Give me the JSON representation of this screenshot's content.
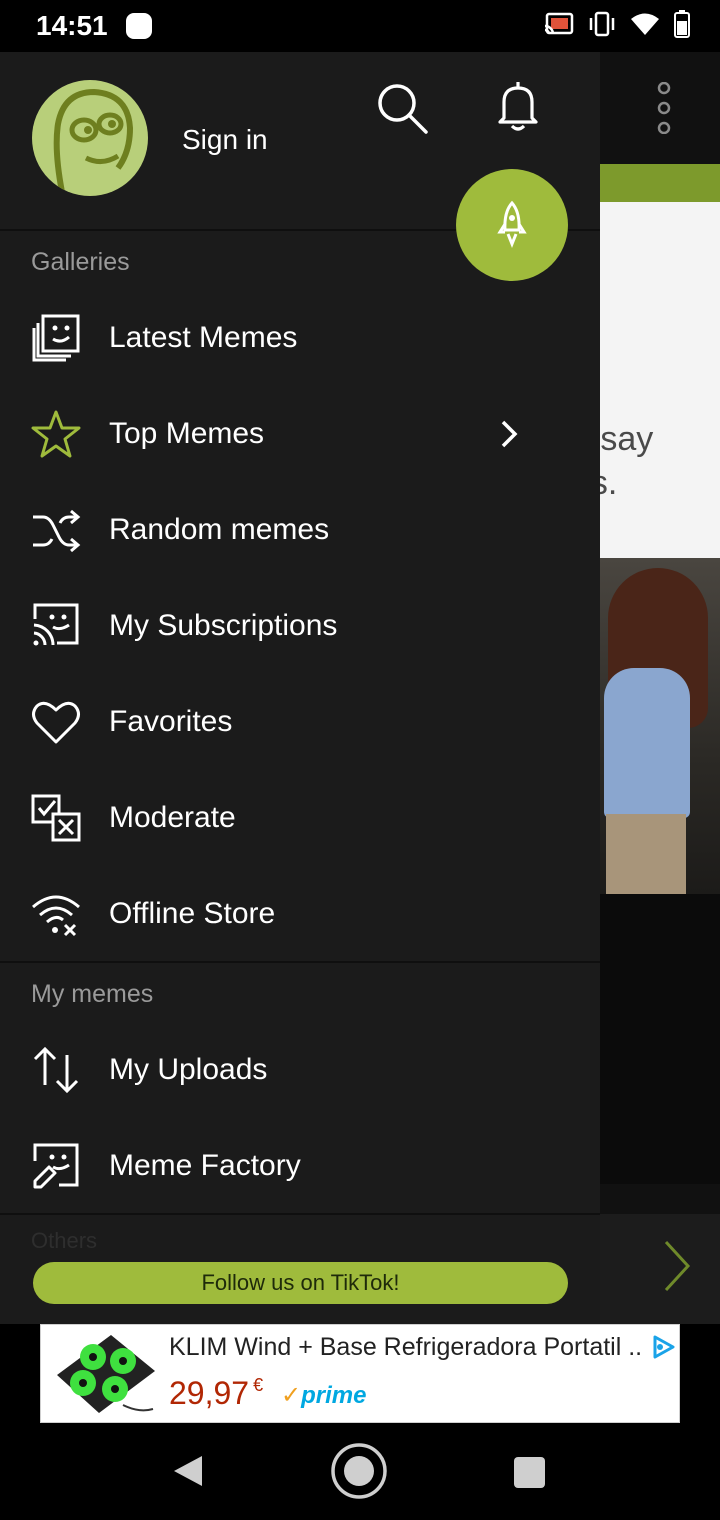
{
  "status_bar": {
    "time": "14:51",
    "icons": [
      "notification-dot",
      "cast-icon",
      "vibrate-icon",
      "wifi-icon",
      "battery-icon"
    ]
  },
  "header": {
    "sign_in_label": "Sign in",
    "search_icon": "search-icon",
    "notifications_icon": "bell-icon",
    "fab_icon": "rocket-icon"
  },
  "sections": {
    "galleries": "Galleries",
    "my_memes": "My memes",
    "others_faded": "Others"
  },
  "menu": {
    "galleries": [
      {
        "label": "Latest Memes",
        "icon": "gallery-stack-icon"
      },
      {
        "label": "Top Memes",
        "icon": "star-icon",
        "has_submenu": true
      },
      {
        "label": "Random memes",
        "icon": "shuffle-icon"
      },
      {
        "label": "My Subscriptions",
        "icon": "subscriptions-icon"
      },
      {
        "label": "Favorites",
        "icon": "heart-icon"
      },
      {
        "label": "Moderate",
        "icon": "moderate-icon"
      },
      {
        "label": "Offline Store",
        "icon": "wifi-off-icon"
      }
    ],
    "my_memes": [
      {
        "label": "My Uploads",
        "icon": "upload-download-icon"
      },
      {
        "label": "Meme Factory",
        "icon": "meme-factory-icon"
      }
    ]
  },
  "tiktok_banner": "Follow us on TikTok!",
  "ad": {
    "title": "KLIM Wind + Base Refrigeradora Portatil ...",
    "price": "29,97",
    "currency": "€",
    "badge": "prime"
  },
  "background_text": {
    "line1": "o say",
    "line2": "ns."
  },
  "colors": {
    "accent": "#9fbb3c",
    "drawer_bg": "#1b1b1b",
    "price": "#b12704",
    "prime": "#00a8e1"
  }
}
